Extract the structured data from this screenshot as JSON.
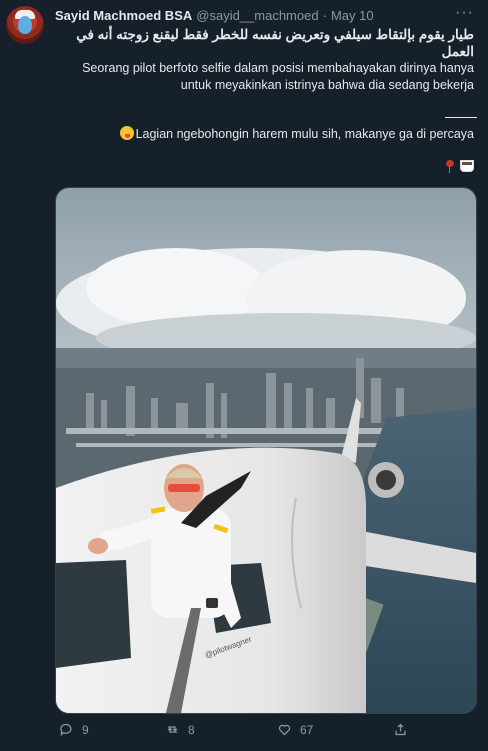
{
  "author": {
    "name": "Sayid Machmoed BSA",
    "handle": "@sayid__machmoed",
    "separator": "·",
    "date": "May 10"
  },
  "more_label": "···",
  "tweet": {
    "arabic": "طيار يقوم بإلتقاط سيلفي وتعريض نفسه للخطر فقط ليقنع زوجته أنه في العمل",
    "translation_line1": "Seorang pilot berfoto selfie dalam posisi membahayakan dirinya hanya",
    "translation_line2": "untuk meyakinkan istrinya bahwa dia sedang bekerja",
    "comment": "Lagian ngebohongin harem mulu sih, makanye ga di percaya"
  },
  "image": {
    "watermark": "@pilotwagner"
  },
  "actions": {
    "reply_count": "9",
    "retweet_count": "8",
    "like_count": "67"
  },
  "icons": [
    "reply-icon",
    "retweet-icon",
    "like-icon",
    "share-icon",
    "more-icon"
  ],
  "colors": {
    "background": "#15202b",
    "text": "#e7e9ea",
    "muted": "#8b98a5"
  }
}
